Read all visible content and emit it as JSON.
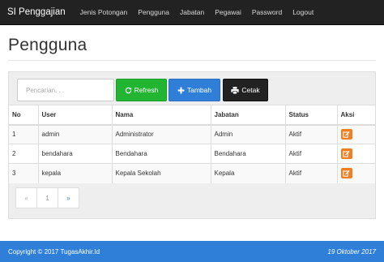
{
  "navbar": {
    "brand": "SI Penggajian",
    "items": [
      "Jenis Potongan",
      "Pengguna",
      "Jabatan",
      "Pegawai",
      "Password",
      "Logout"
    ]
  },
  "page": {
    "title": "Pengguna"
  },
  "toolbar": {
    "search_placeholder": "Pencarian. . .",
    "refresh_label": "Refresh",
    "tambah_label": "Tambah",
    "cetak_label": "Cetak"
  },
  "table": {
    "headers": [
      "No",
      "User",
      "Nama",
      "Jabatan",
      "Status",
      "Aksi"
    ],
    "rows": [
      {
        "no": "1",
        "user": "admin",
        "nama": "Administrator",
        "jabatan": "Admin",
        "status": "Aktif"
      },
      {
        "no": "2",
        "user": "bendahara",
        "nama": "Bendahara",
        "jabatan": "Bendahara",
        "status": "Aktif"
      },
      {
        "no": "3",
        "user": "kepala",
        "nama": "Kepala Sekolah",
        "jabatan": "Kepala",
        "status": "Aktif"
      }
    ]
  },
  "pagination": {
    "prev": "«",
    "current": "1",
    "next": "»"
  },
  "footer": {
    "copyright": "Copyright © 2017 TugasAkhir.Id",
    "date": "19 Oktober 2017"
  },
  "colors": {
    "navbar": "#222222",
    "refresh": "#21b531",
    "tambah": "#2f7fd8",
    "cetak": "#222222",
    "edit": "#ef7f23",
    "footer": "#2f7fd8"
  },
  "icons": {
    "refresh": "refresh-icon",
    "tambah": "plus-icon",
    "cetak": "print-icon",
    "edit": "edit-icon"
  }
}
